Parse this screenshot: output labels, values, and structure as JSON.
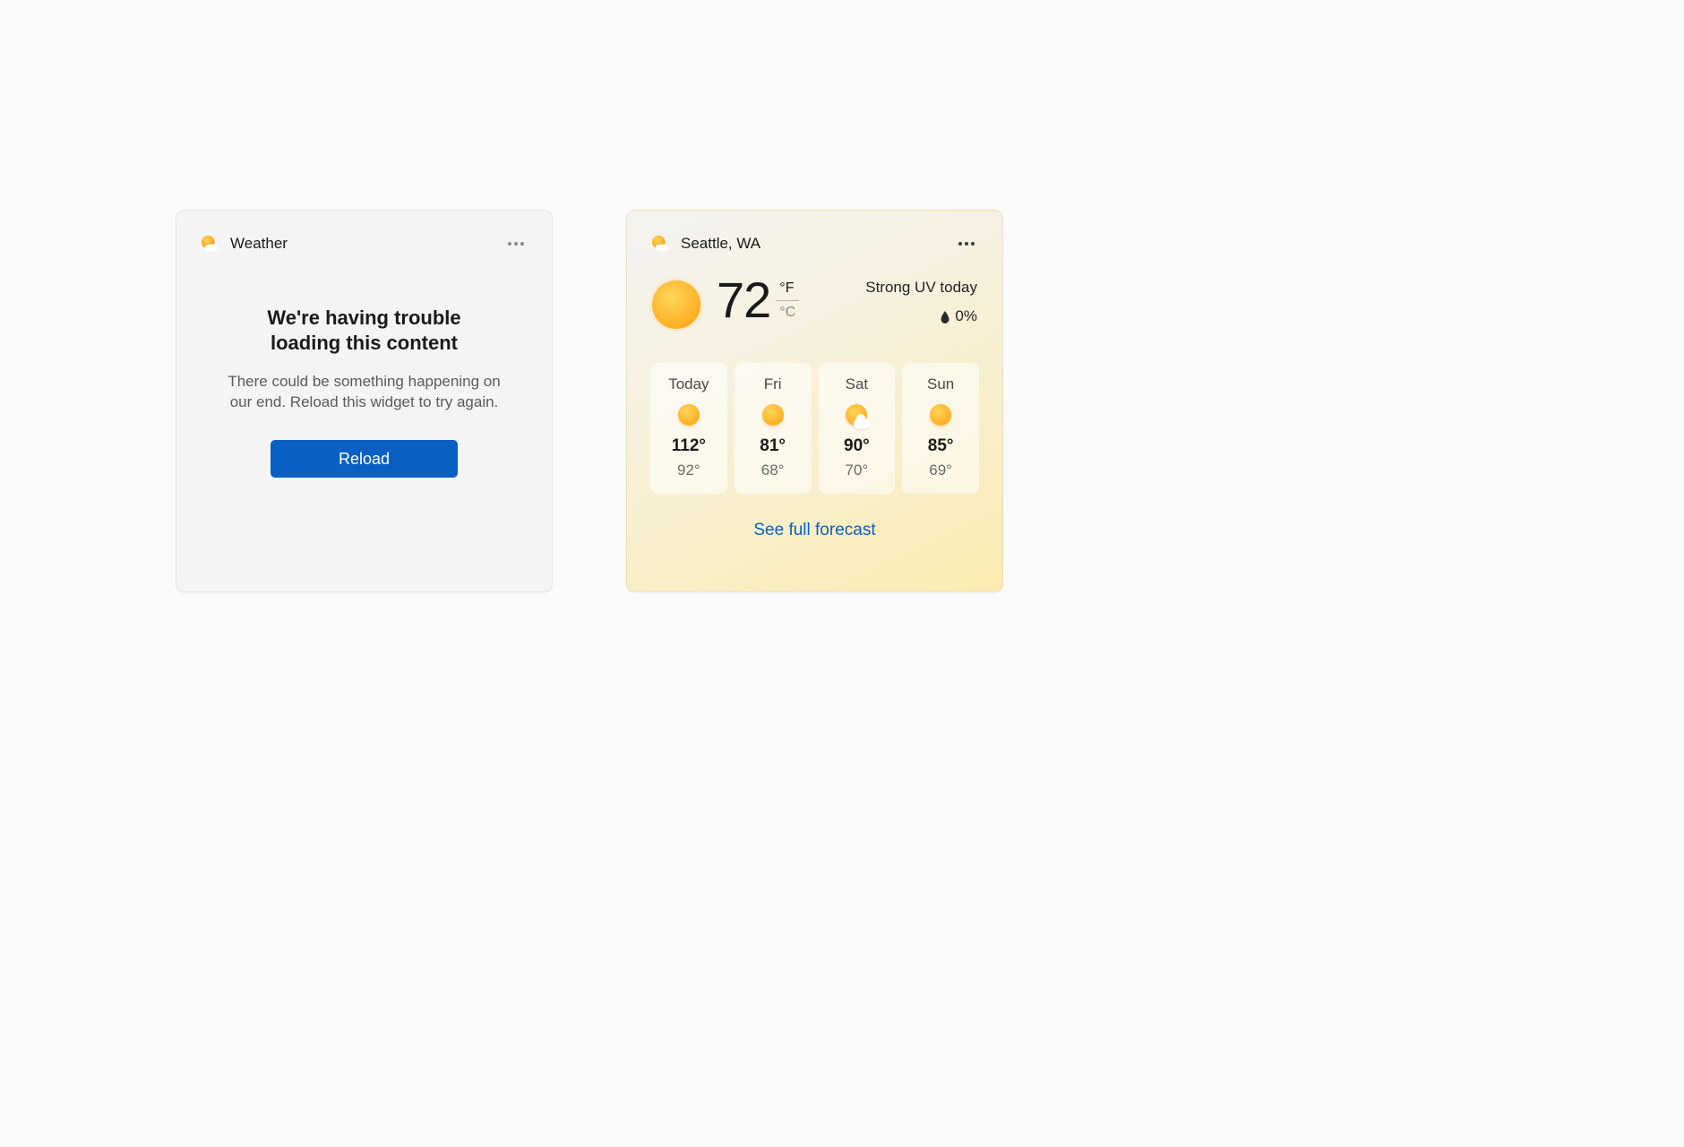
{
  "error_card": {
    "title": "Weather",
    "heading": "We're having trouble loading this content",
    "description": "There could be something happening on our end. Reload this widget to try again.",
    "reload_label": "Reload"
  },
  "weather_card": {
    "location": "Seattle, WA",
    "temp": "72",
    "unit_f": "°F",
    "unit_c": "°C",
    "uv_text": "Strong UV today",
    "precip": "0%",
    "forecast": [
      {
        "day": "Today",
        "hi": "112°",
        "lo": "92°",
        "icon": "sunny"
      },
      {
        "day": "Fri",
        "hi": "81°",
        "lo": "68°",
        "icon": "sunny"
      },
      {
        "day": "Sat",
        "hi": "90°",
        "lo": "70°",
        "icon": "partly-cloudy"
      },
      {
        "day": "Sun",
        "hi": "85°",
        "lo": "69°",
        "icon": "sunny"
      }
    ],
    "link_label": "See full forecast"
  }
}
